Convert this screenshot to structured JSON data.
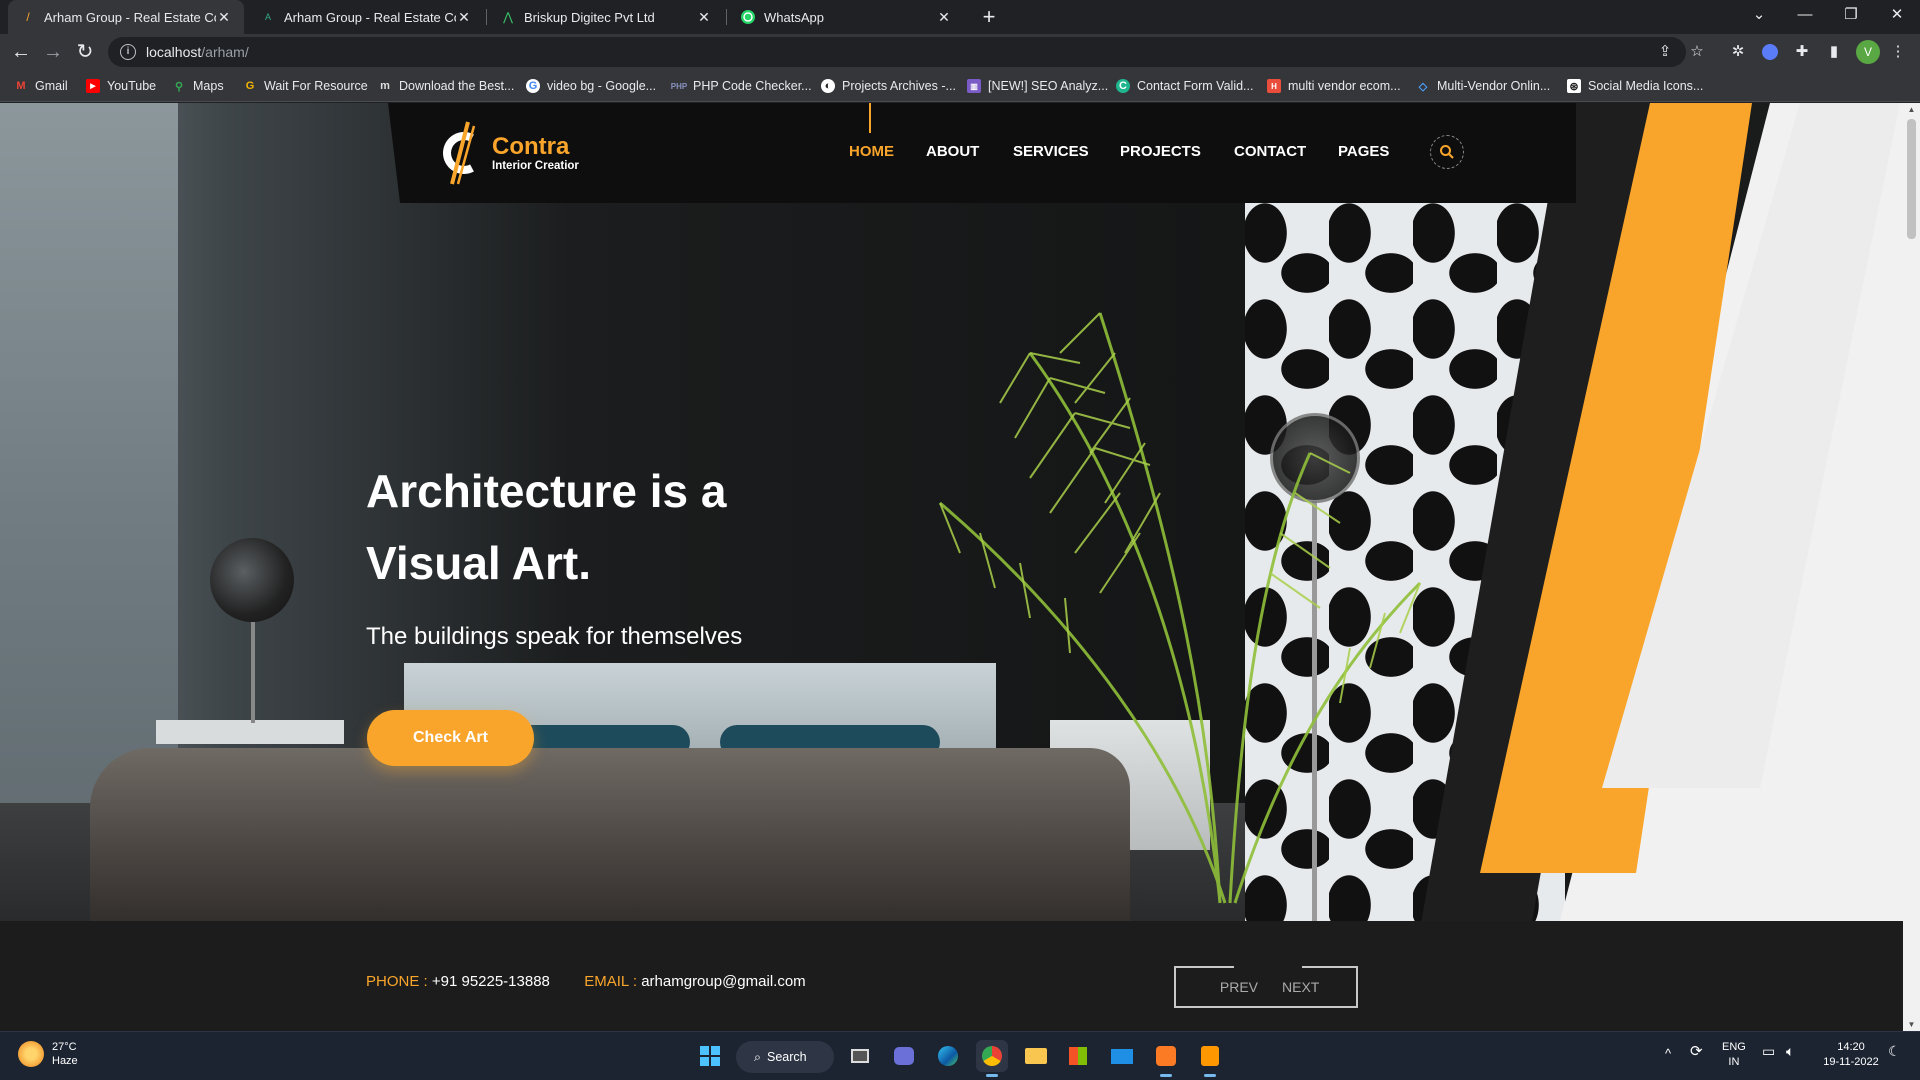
{
  "browser": {
    "tabs": [
      {
        "title": "Arham Group - Real Estate Coma",
        "active": true
      },
      {
        "title": "Arham Group - Real Estate Coma",
        "active": false
      },
      {
        "title": "Briskup Digitec Pvt Ltd",
        "active": false
      },
      {
        "title": "WhatsApp",
        "active": false
      }
    ],
    "address": {
      "host": "localhost",
      "path": "/arham/"
    },
    "bookmarks": [
      {
        "label": "Gmail",
        "icon": "gmail-icon"
      },
      {
        "label": "YouTube",
        "icon": "youtube-icon"
      },
      {
        "label": "Maps",
        "icon": "maps-icon"
      },
      {
        "label": "Wait For Resource",
        "icon": "g-icon"
      },
      {
        "label": "Download the Best...",
        "icon": "m-icon"
      },
      {
        "label": "video bg - Google...",
        "icon": "google-icon"
      },
      {
        "label": "PHP Code Checker...",
        "icon": "php-icon"
      },
      {
        "label": "Projects Archives -...",
        "icon": "globe-icon"
      },
      {
        "label": "[NEW!] SEO Analyz...",
        "icon": "seo-icon"
      },
      {
        "label": "Contact Form Valid...",
        "icon": "form-icon"
      },
      {
        "label": "multi vendor ecom...",
        "icon": "ecom-icon"
      },
      {
        "label": "Multi-Vendor Onlin...",
        "icon": "diamond-icon"
      },
      {
        "label": "Social Media Icons...",
        "icon": "social-icon"
      }
    ],
    "profile_initial": "V"
  },
  "site": {
    "logo": {
      "name": "Contra",
      "tagline": "Interior Creatior"
    },
    "nav": [
      "HOME",
      "ABOUT",
      "SERVICES",
      "PROJECTS",
      "CONTACT",
      "PAGES"
    ],
    "active_nav": "HOME",
    "hero": {
      "title_line1": "Architecture is a",
      "title_line2": "Visual Art.",
      "subtitle": "The buildings speak for themselves",
      "cta": "Check Art"
    },
    "contact": {
      "phone_label": "PHONE :",
      "phone": "+91 95225-13888",
      "email_label": "EMAIL :",
      "email": "arhamgroup@gmail.com"
    },
    "pager": {
      "prev": "PREV",
      "next": "NEXT"
    },
    "colors": {
      "accent": "#f9a52b",
      "dark": "#0e0e0e",
      "footer": "#1c1c1c"
    }
  },
  "taskbar": {
    "weather": {
      "temp": "27°C",
      "condition": "Haze"
    },
    "search_label": "Search",
    "lang": {
      "line1": "ENG",
      "line2": "IN"
    },
    "clock": {
      "time": "14:20",
      "date": "19-11-2022"
    }
  }
}
